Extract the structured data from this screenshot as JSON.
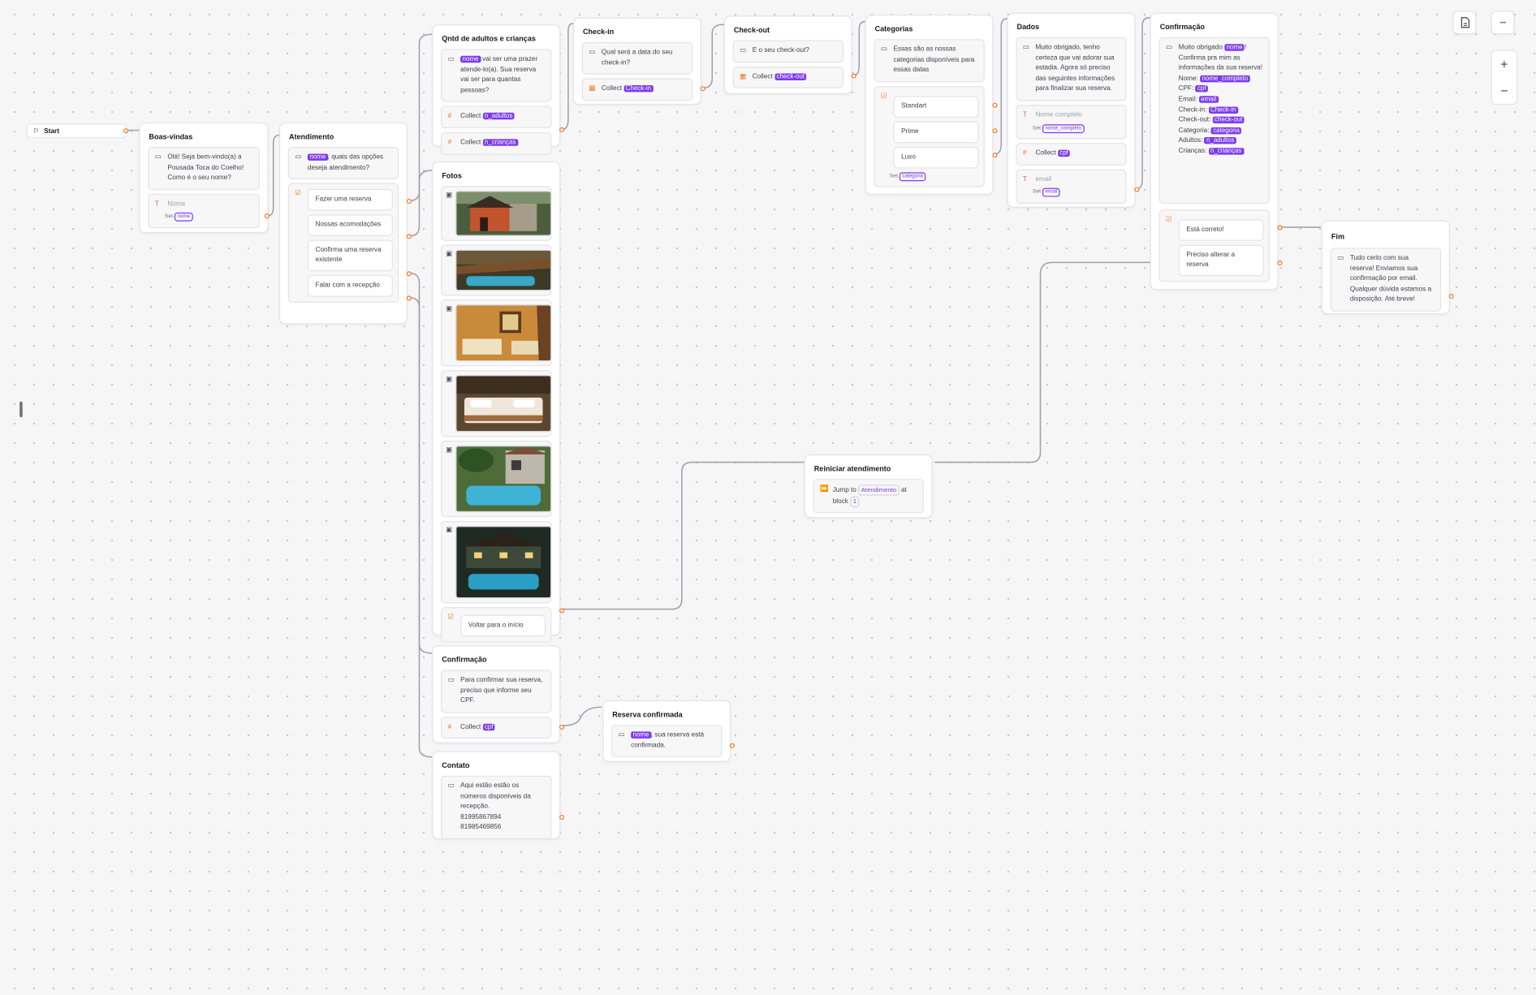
{
  "start": {
    "label": "Start"
  },
  "welcome": {
    "title": "Boas-vindas",
    "message": "Olá! Seja bem-vindo(a) a Pousada Toca do Coelho! Como é o seu nome?",
    "input_placeholder": "Nome",
    "set_label": "Set",
    "set_var": "nome"
  },
  "service": {
    "title": "Atendimento",
    "var": "nome",
    "message": ", quais das opções deseja atendimento?",
    "options": [
      "Fazer uma reserva",
      "Nossas acomodações",
      "Confirma uma reserva existente",
      "Falar com a recepção"
    ]
  },
  "guests": {
    "title": "Qntd de adultos e crianças",
    "var": "nome",
    "message": " vai ser uma prazer atende-lo(a). Sua reserva vai ser para quantas pessoas?",
    "collect_label": "Collect",
    "collect_adults": "n_adultos",
    "collect_children": "n_crianças"
  },
  "checkin": {
    "title": "Check-in",
    "message": "Qual será a data do seu check-in?",
    "collect_label": "Collect",
    "collect_var": "Check-in"
  },
  "checkout": {
    "title": "Check-out",
    "message": "E o seu check-out?",
    "collect_label": "Collect",
    "collect_var": "check-out"
  },
  "categories": {
    "title": "Categorias",
    "message": "Essas são as nossas categorias disponíveis para essas datas",
    "options": [
      "Standart",
      "Prime",
      "Luxo"
    ],
    "set_label": "Set",
    "set_var": "categoria"
  },
  "data_group": {
    "title": "Dados",
    "message": "Muito obrigado, tenho certeza que vai adorar sua estadia. Agora só preciso das seguintes informações para finalizar sua reserva.",
    "name_placeholder": "Nome completo",
    "name_set_label": "Set",
    "name_var": "nome_completo",
    "collect_label": "Collect",
    "collect_cpf": "cpf",
    "email_placeholder": "email",
    "email_set_label": "Set",
    "email_var": "email"
  },
  "confirmation": {
    "title": "Confirmação",
    "line1_prefix": "Muito obrigado",
    "line1_var": "nome",
    "line1_suffix": "!",
    "line2": "Confirma pra mim as informações da sua reserva!",
    "rows": [
      {
        "label": "Nome:",
        "var": "nome_completo"
      },
      {
        "label": "CPF:",
        "var": "cpf"
      },
      {
        "label": "Email:",
        "var": "email"
      },
      {
        "label": "Check-in:",
        "var": "Check-in"
      },
      {
        "label": "Check-out:",
        "var": "check-out"
      },
      {
        "label": "Categoria:",
        "var": "categoria"
      },
      {
        "label": "Adultos:",
        "var": "n_adultos"
      },
      {
        "label": "Crianças:",
        "var": "n_crianças"
      }
    ],
    "options": [
      "Está correto!",
      "Preciso alterar a reserva"
    ]
  },
  "end": {
    "title": "Fim",
    "message": "Tudo certo com sua reserva! Enviamos sua confirmação por email. Qualquer dúvida estamos a disposição. Até breve!"
  },
  "photos": {
    "title": "Fotos",
    "button": "Voltar para o início"
  },
  "restart": {
    "title": "Reiniciar atendimento",
    "jump_label": "Jump to",
    "jump_target": "Atendimento",
    "at_block": "at block",
    "block_num": "1"
  },
  "confirm_existing": {
    "title": "Confirmação",
    "message": "Para confirmar sua reserva, preciso que informe seu CPF.",
    "collect_label": "Collect",
    "collect_var": "cpf"
  },
  "reservation_confirmed": {
    "title": "Reserva confirmada",
    "var": "nome",
    "message": ", sua reserva está confirmada."
  },
  "contact": {
    "title": "Contato",
    "message": "Aqui estão estão os números disponíveis da recepção.",
    "phone1": "81995867894",
    "phone2": "81985469856"
  },
  "toolbar": {
    "zoom_in": "+",
    "zoom_out": "−",
    "more": "···"
  },
  "colors": {
    "accent": "#7c3aed",
    "port": "#f97316",
    "edge": "#a1a1aa",
    "canvas": "#f6f6f7"
  }
}
